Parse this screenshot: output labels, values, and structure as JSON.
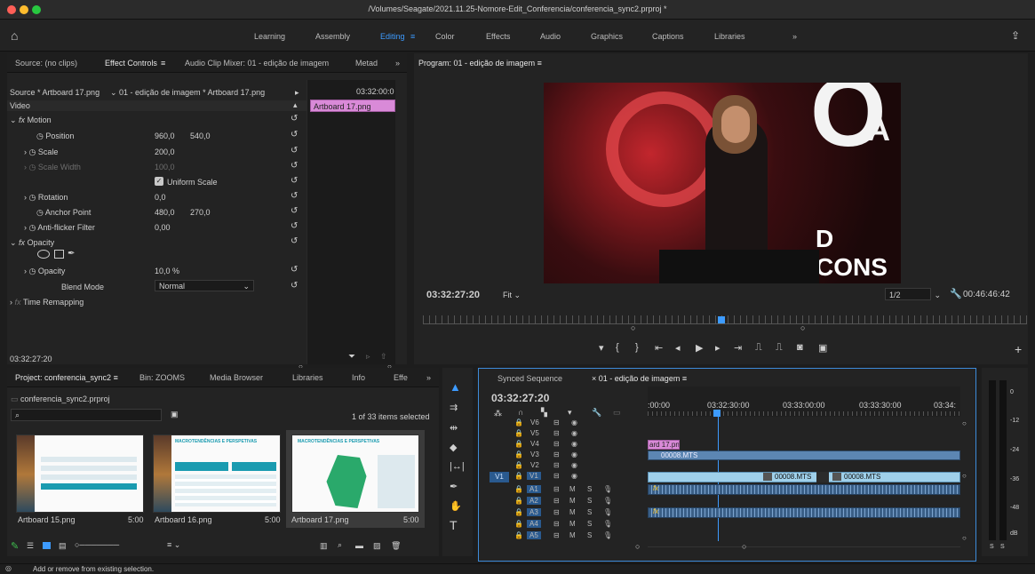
{
  "window": {
    "title": "/Volumes/Seagate/2021.11.25-Nomore-Edit_Conferencia/conferencia_sync2.prproj *"
  },
  "workspaces": [
    "Learning",
    "Assembly",
    "Editing",
    "Color",
    "Effects",
    "Audio",
    "Graphics",
    "Captions",
    "Libraries"
  ],
  "workspace_more": "»",
  "effect_panel": {
    "tabs": [
      "Source: (no clips)",
      "Effect Controls",
      "Audio Clip Mixer: 01 - edição de imagem",
      "Metad"
    ],
    "tabs_more": "»",
    "source_label": "Source * Artboard 17.png",
    "sequence_label": "01 - edição de imagem * Artboard 17.png",
    "mini_time": "03:32:00:0",
    "mini_clip": "Artboard 17.png",
    "video_label": "Video",
    "motion": "Motion",
    "position": {
      "label": "Position",
      "x": "960,0",
      "y": "540,0"
    },
    "scale": {
      "label": "Scale",
      "value": "200,0"
    },
    "scale_width": {
      "label": "Scale Width",
      "value": "100,0"
    },
    "uniform_scale": "Uniform Scale",
    "rotation": {
      "label": "Rotation",
      "value": "0,0"
    },
    "anchor": {
      "label": "Anchor Point",
      "x": "480,0",
      "y": "270,0"
    },
    "antiflicker": {
      "label": "Anti-flicker Filter",
      "value": "0,00"
    },
    "opacity_group": "Opacity",
    "opacity": {
      "label": "Opacity",
      "value": "10,0 %"
    },
    "blend": {
      "label": "Blend Mode",
      "value": "Normal"
    },
    "time_remap": "Time Remapping",
    "timecode": "03:32:27:20"
  },
  "program": {
    "title": "Program: 01 - edição de imagem",
    "timecode": "03:32:27:20",
    "fit": "Fit",
    "resolution": "1/2",
    "duration": "00:46:46:42",
    "video_text_top": "A",
    "video_text_bottom": "D CONS",
    "video_logo": "O"
  },
  "project": {
    "tabs": [
      "Project: conferencia_sync2",
      "Bin: ZOOMS",
      "Media Browser",
      "Libraries",
      "Info",
      "Effe"
    ],
    "tabs_more": "»",
    "file": "conferencia_sync2.prproj",
    "selected_count": "1 of 33 items selected",
    "items": [
      {
        "name": "Artboard 15.png",
        "duration": "5:00"
      },
      {
        "name": "Artboard 16.png",
        "duration": "5:00"
      },
      {
        "name": "Artboard 17.png",
        "duration": "5:00"
      }
    ],
    "thumb_heading": "MACROTENDÊNCIAS E PERSPETIVAS"
  },
  "timeline": {
    "tabs": [
      "Synced Sequence",
      "01 - edição de imagem"
    ],
    "timecode": "03:32:27:20",
    "ruler": [
      ":00:00",
      "03:32:30:00",
      "03:33:00:00",
      "03:33:30:00",
      "03:34:"
    ],
    "video_tracks": [
      "V6",
      "V5",
      "V4",
      "V3",
      "V2",
      "V1"
    ],
    "audio_tracks": [
      "A1",
      "A2",
      "A3",
      "A4",
      "A5"
    ],
    "v1_source": "V1",
    "a1_source": "A1",
    "clip_v4": "ard 17.pn",
    "clip_v3": "00008.MTS",
    "clip_v1a": "00008.MTS",
    "clip_v1b": "00008.MTS",
    "fx": "fx"
  },
  "meter": {
    "labels": [
      "0",
      "-12",
      "-24",
      "-36",
      "-48",
      "dB"
    ],
    "solo": [
      "S",
      "S"
    ]
  },
  "status": "Add or remove from existing selection."
}
